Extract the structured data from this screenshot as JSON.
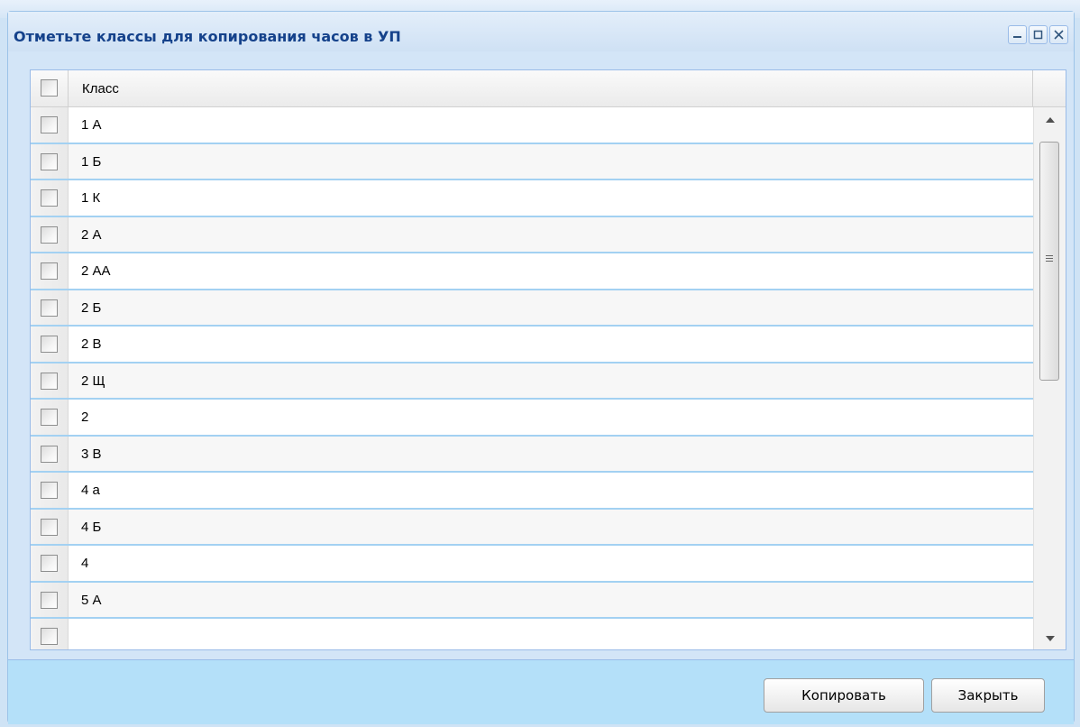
{
  "dialog": {
    "title": "Отметьте классы для копирования часов в УП",
    "tools": {
      "minimize": "minimize-icon",
      "maximize": "maximize-icon",
      "close": "close-icon"
    }
  },
  "grid": {
    "column_header": "Класс",
    "rows": [
      "1 А",
      "1 Б",
      "1 К",
      "2 А",
      "2 АА",
      "2 Б",
      "2 В",
      "2 Щ",
      "2",
      "3 В",
      "4 а",
      "4 Б",
      "4",
      "5 А",
      ""
    ]
  },
  "buttons": {
    "copy": "Копировать",
    "close": "Закрыть"
  },
  "colors": {
    "title_text": "#15428b",
    "row_separator": "#a3d1f2",
    "footer_bg": "#b4e0f9"
  }
}
